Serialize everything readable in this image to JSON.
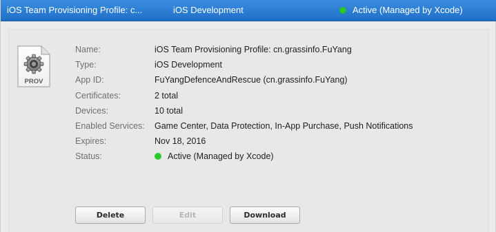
{
  "header": {
    "name": "iOS Team Provisioning Profile: c...",
    "type": "iOS Development",
    "status": "Active (Managed by Xcode)",
    "status_color": "#2cc72c"
  },
  "icon": {
    "name": "provisioning-profile-file-icon",
    "label": "PROV"
  },
  "details": [
    {
      "label": "Name:",
      "value": "iOS Team Provisioning Profile: cn.grassinfo.FuYang"
    },
    {
      "label": "Type:",
      "value": "iOS Development"
    },
    {
      "label": "App ID:",
      "value": "FuYangDefenceAndRescue (cn.grassinfo.FuYang)"
    },
    {
      "label": "Certificates:",
      "value": "2 total"
    },
    {
      "label": "Devices:",
      "value": "10 total"
    },
    {
      "label": "Enabled Services:",
      "value": "Game Center, Data Protection, In-App Purchase, Push Notifications"
    },
    {
      "label": "Expires:",
      "value": "Nov 18, 2016"
    },
    {
      "label": "Status:",
      "value": "Active (Managed by Xcode)"
    }
  ],
  "buttons": {
    "delete": "Delete",
    "edit": "Edit",
    "download": "Download"
  }
}
